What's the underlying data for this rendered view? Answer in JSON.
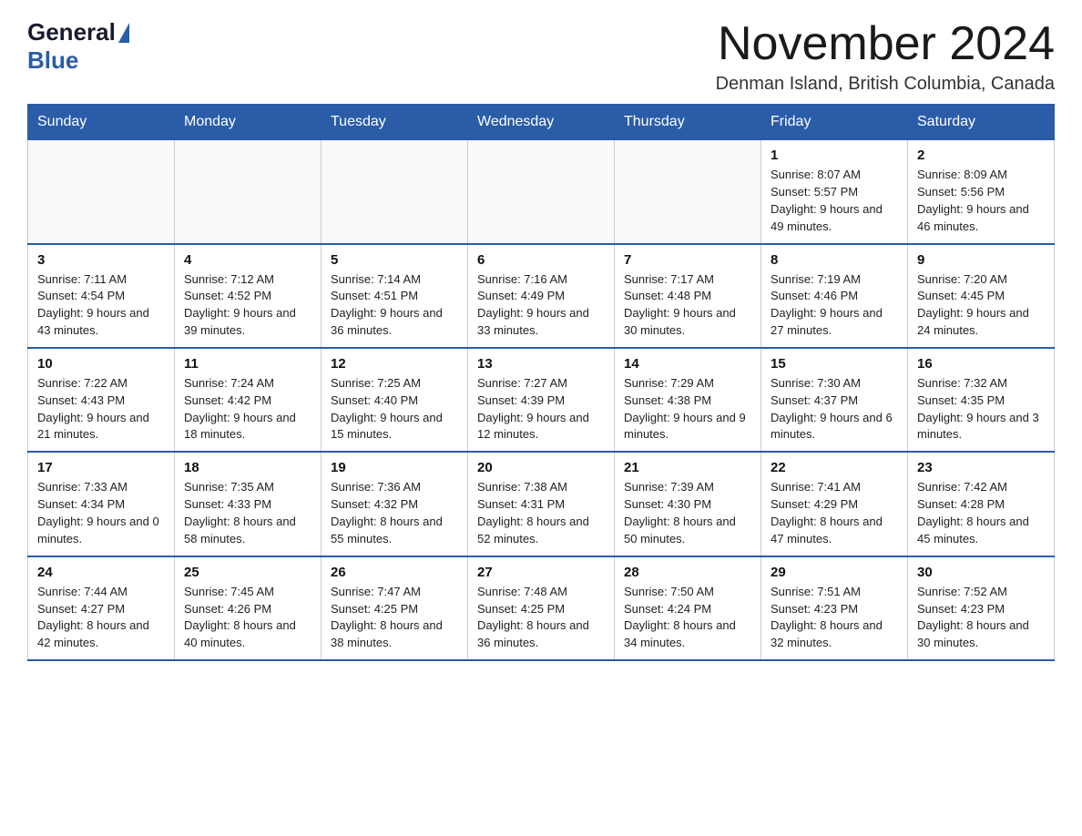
{
  "logo": {
    "text_general": "General",
    "text_blue": "Blue"
  },
  "header": {
    "month_title": "November 2024",
    "location": "Denman Island, British Columbia, Canada"
  },
  "days_of_week": [
    "Sunday",
    "Monday",
    "Tuesday",
    "Wednesday",
    "Thursday",
    "Friday",
    "Saturday"
  ],
  "weeks": [
    [
      {
        "day": "",
        "info": ""
      },
      {
        "day": "",
        "info": ""
      },
      {
        "day": "",
        "info": ""
      },
      {
        "day": "",
        "info": ""
      },
      {
        "day": "",
        "info": ""
      },
      {
        "day": "1",
        "info": "Sunrise: 8:07 AM\nSunset: 5:57 PM\nDaylight: 9 hours and 49 minutes."
      },
      {
        "day": "2",
        "info": "Sunrise: 8:09 AM\nSunset: 5:56 PM\nDaylight: 9 hours and 46 minutes."
      }
    ],
    [
      {
        "day": "3",
        "info": "Sunrise: 7:11 AM\nSunset: 4:54 PM\nDaylight: 9 hours and 43 minutes."
      },
      {
        "day": "4",
        "info": "Sunrise: 7:12 AM\nSunset: 4:52 PM\nDaylight: 9 hours and 39 minutes."
      },
      {
        "day": "5",
        "info": "Sunrise: 7:14 AM\nSunset: 4:51 PM\nDaylight: 9 hours and 36 minutes."
      },
      {
        "day": "6",
        "info": "Sunrise: 7:16 AM\nSunset: 4:49 PM\nDaylight: 9 hours and 33 minutes."
      },
      {
        "day": "7",
        "info": "Sunrise: 7:17 AM\nSunset: 4:48 PM\nDaylight: 9 hours and 30 minutes."
      },
      {
        "day": "8",
        "info": "Sunrise: 7:19 AM\nSunset: 4:46 PM\nDaylight: 9 hours and 27 minutes."
      },
      {
        "day": "9",
        "info": "Sunrise: 7:20 AM\nSunset: 4:45 PM\nDaylight: 9 hours and 24 minutes."
      }
    ],
    [
      {
        "day": "10",
        "info": "Sunrise: 7:22 AM\nSunset: 4:43 PM\nDaylight: 9 hours and 21 minutes."
      },
      {
        "day": "11",
        "info": "Sunrise: 7:24 AM\nSunset: 4:42 PM\nDaylight: 9 hours and 18 minutes."
      },
      {
        "day": "12",
        "info": "Sunrise: 7:25 AM\nSunset: 4:40 PM\nDaylight: 9 hours and 15 minutes."
      },
      {
        "day": "13",
        "info": "Sunrise: 7:27 AM\nSunset: 4:39 PM\nDaylight: 9 hours and 12 minutes."
      },
      {
        "day": "14",
        "info": "Sunrise: 7:29 AM\nSunset: 4:38 PM\nDaylight: 9 hours and 9 minutes."
      },
      {
        "day": "15",
        "info": "Sunrise: 7:30 AM\nSunset: 4:37 PM\nDaylight: 9 hours and 6 minutes."
      },
      {
        "day": "16",
        "info": "Sunrise: 7:32 AM\nSunset: 4:35 PM\nDaylight: 9 hours and 3 minutes."
      }
    ],
    [
      {
        "day": "17",
        "info": "Sunrise: 7:33 AM\nSunset: 4:34 PM\nDaylight: 9 hours and 0 minutes."
      },
      {
        "day": "18",
        "info": "Sunrise: 7:35 AM\nSunset: 4:33 PM\nDaylight: 8 hours and 58 minutes."
      },
      {
        "day": "19",
        "info": "Sunrise: 7:36 AM\nSunset: 4:32 PM\nDaylight: 8 hours and 55 minutes."
      },
      {
        "day": "20",
        "info": "Sunrise: 7:38 AM\nSunset: 4:31 PM\nDaylight: 8 hours and 52 minutes."
      },
      {
        "day": "21",
        "info": "Sunrise: 7:39 AM\nSunset: 4:30 PM\nDaylight: 8 hours and 50 minutes."
      },
      {
        "day": "22",
        "info": "Sunrise: 7:41 AM\nSunset: 4:29 PM\nDaylight: 8 hours and 47 minutes."
      },
      {
        "day": "23",
        "info": "Sunrise: 7:42 AM\nSunset: 4:28 PM\nDaylight: 8 hours and 45 minutes."
      }
    ],
    [
      {
        "day": "24",
        "info": "Sunrise: 7:44 AM\nSunset: 4:27 PM\nDaylight: 8 hours and 42 minutes."
      },
      {
        "day": "25",
        "info": "Sunrise: 7:45 AM\nSunset: 4:26 PM\nDaylight: 8 hours and 40 minutes."
      },
      {
        "day": "26",
        "info": "Sunrise: 7:47 AM\nSunset: 4:25 PM\nDaylight: 8 hours and 38 minutes."
      },
      {
        "day": "27",
        "info": "Sunrise: 7:48 AM\nSunset: 4:25 PM\nDaylight: 8 hours and 36 minutes."
      },
      {
        "day": "28",
        "info": "Sunrise: 7:50 AM\nSunset: 4:24 PM\nDaylight: 8 hours and 34 minutes."
      },
      {
        "day": "29",
        "info": "Sunrise: 7:51 AM\nSunset: 4:23 PM\nDaylight: 8 hours and 32 minutes."
      },
      {
        "day": "30",
        "info": "Sunrise: 7:52 AM\nSunset: 4:23 PM\nDaylight: 8 hours and 30 minutes."
      }
    ]
  ]
}
